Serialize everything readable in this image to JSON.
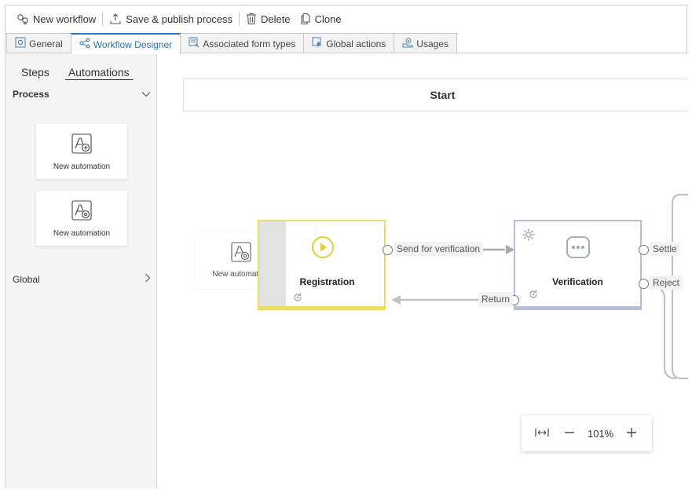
{
  "toolbar": {
    "new_workflow": "New workflow",
    "save_publish": "Save & publish process",
    "delete": "Delete",
    "clone": "Clone"
  },
  "tabs": [
    {
      "label": "General",
      "icon": "gear-icon"
    },
    {
      "label": "Workflow Designer",
      "icon": "workflow-icon",
      "active": true
    },
    {
      "label": "Associated form types",
      "icon": "form-icon"
    },
    {
      "label": "Global actions",
      "icon": "action-icon"
    },
    {
      "label": "Usages",
      "icon": "usages-icon"
    }
  ],
  "panel": {
    "tab_steps": "Steps",
    "tab_automations": "Automations",
    "section_process": "Process",
    "section_global": "Global",
    "cards": [
      {
        "label": "New automation",
        "icon": "automation-add-icon"
      },
      {
        "label": "New automation",
        "icon": "automation-gear-icon"
      }
    ]
  },
  "canvas": {
    "start_label": "Start",
    "ghost_automation": "New automation",
    "steps": {
      "registration": "Registration",
      "verification": "Verification"
    },
    "flows": {
      "send_for_verification": "Send for verification",
      "return": "Return",
      "settle": "Settle",
      "reject": "Reject"
    }
  },
  "zoom": {
    "level": "101%"
  },
  "colors": {
    "accent": "#2a73b8",
    "registration": "#eedb6a",
    "verification": "#b8bdd8"
  }
}
